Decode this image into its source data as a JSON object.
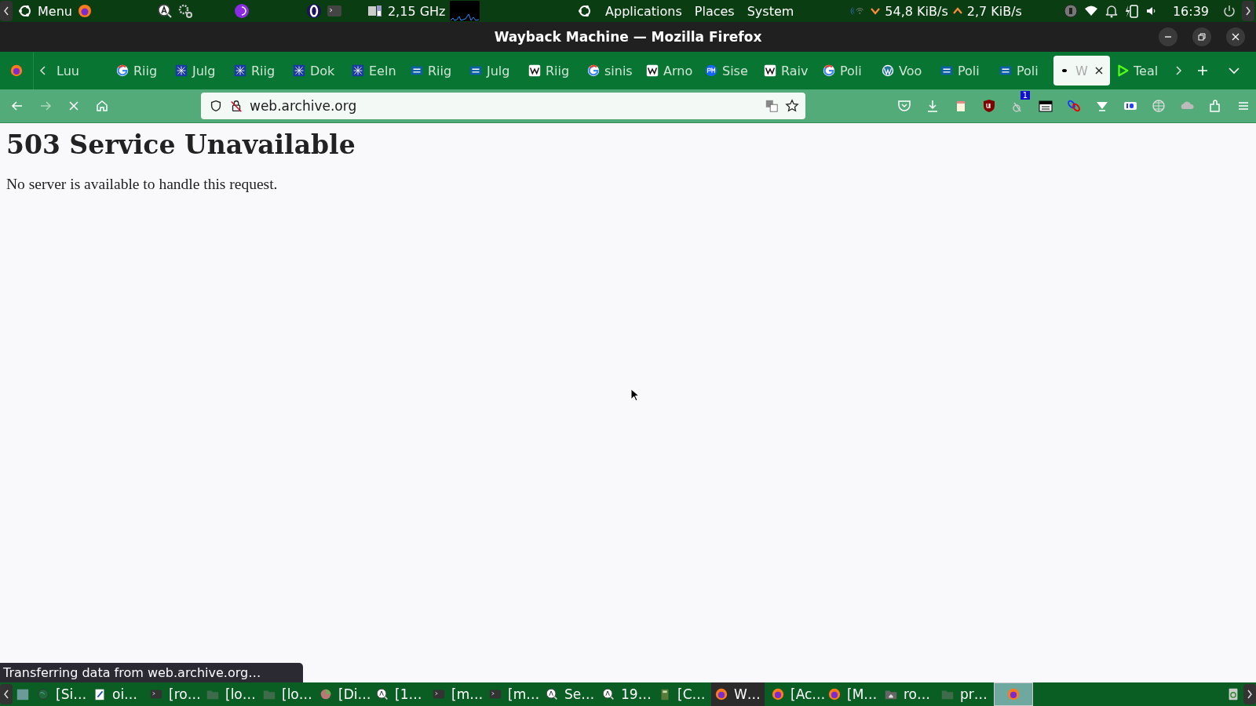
{
  "top_panel": {
    "menu_label": "Menu",
    "cpu_freq": "2,15 GHz",
    "menus": [
      "Applications",
      "Places",
      "System"
    ],
    "net_down": "54,8 KiB/s",
    "net_up": "2,7 KiB/s",
    "clock": "16:39"
  },
  "window": {
    "title": "Wayback Machine — Mozilla Firefox"
  },
  "tabs": [
    {
      "label": "Luu",
      "kind": "plain",
      "selected": false
    },
    {
      "label": "Riig",
      "kind": "g",
      "selected": false
    },
    {
      "label": "Julg",
      "kind": "grid",
      "selected": false
    },
    {
      "label": "Riig",
      "kind": "grid",
      "selected": false
    },
    {
      "label": "Dok",
      "kind": "grid",
      "selected": false
    },
    {
      "label": "Eeln",
      "kind": "grid",
      "selected": false
    },
    {
      "label": "Riig",
      "kind": "rt",
      "selected": false
    },
    {
      "label": "Julg",
      "kind": "rt",
      "selected": false
    },
    {
      "label": "Riig",
      "kind": "w",
      "selected": false
    },
    {
      "label": "sinis",
      "kind": "g",
      "selected": false
    },
    {
      "label": "Arno",
      "kind": "w",
      "selected": false
    },
    {
      "label": "Sise",
      "kind": "pm",
      "selected": false
    },
    {
      "label": "Raiv",
      "kind": "w",
      "selected": false
    },
    {
      "label": "Poli",
      "kind": "g",
      "selected": false
    },
    {
      "label": "Voo",
      "kind": "wp",
      "selected": false
    },
    {
      "label": "Poli",
      "kind": "rt",
      "selected": false
    },
    {
      "label": "Poli",
      "kind": "rt",
      "selected": false
    },
    {
      "label": "W",
      "kind": "dot",
      "selected": true
    },
    {
      "label": "Teal",
      "kind": "play",
      "selected": false
    }
  ],
  "toolbar": {
    "url": "web.archive.org",
    "extension_badge": "1"
  },
  "page": {
    "heading": "503 Service Unavailable",
    "message": "No server is available to handle this request."
  },
  "status_bar": "Transferring data from web.archive.org…",
  "taskbar": [
    {
      "label": "[Si…",
      "kind": "globe",
      "selected": false
    },
    {
      "label": "oi…",
      "kind": "note",
      "selected": false
    },
    {
      "label": "[ro…",
      "kind": "terminal",
      "selected": false
    },
    {
      "label": "[lo…",
      "kind": "folder",
      "selected": false
    },
    {
      "label": "[lo…",
      "kind": "folder",
      "selected": false
    },
    {
      "label": "[Di…",
      "kind": "pie",
      "selected": false
    },
    {
      "label": "[1…",
      "kind": "search",
      "selected": false
    },
    {
      "label": "[m…",
      "kind": "terminal",
      "selected": false
    },
    {
      "label": "[m…",
      "kind": "terminal",
      "selected": false
    },
    {
      "label": "Se…",
      "kind": "search",
      "selected": false
    },
    {
      "label": "19…",
      "kind": "search",
      "selected": false
    },
    {
      "label": "[C…",
      "kind": "calc",
      "selected": false
    },
    {
      "label": "W…",
      "kind": "firefox",
      "selected": true
    },
    {
      "label": "[Ac…",
      "kind": "firefox",
      "selected": false
    },
    {
      "label": "[M…",
      "kind": "firefox",
      "selected": false
    },
    {
      "label": "ro…",
      "kind": "home",
      "selected": false
    },
    {
      "label": "pr…",
      "kind": "folder",
      "selected": false
    },
    {
      "kind": "firefox",
      "selected": true
    }
  ]
}
